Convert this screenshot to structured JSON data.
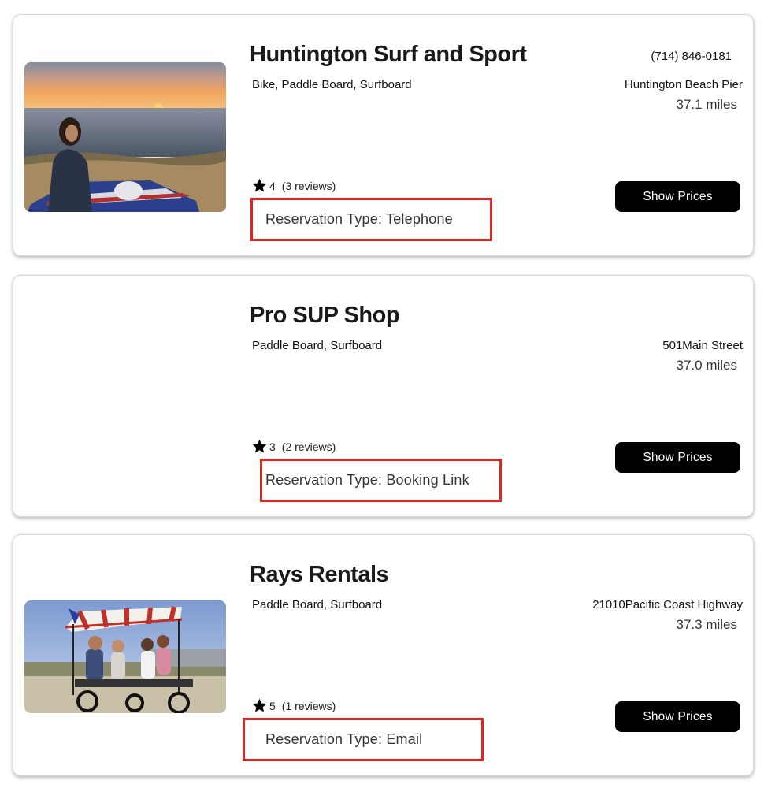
{
  "listings": [
    {
      "title": "Huntington Surf and Sport",
      "types": "Bike, Paddle Board, Surfboard",
      "phone": "(714) 846-0181",
      "address": "Huntington Beach Pier",
      "distance": "37.1 miles",
      "rating": "4",
      "reviews": "(3 reviews)",
      "reservation": "Reservation Type: Telephone",
      "button": "Show Prices",
      "image": "sunset-beach-photo"
    },
    {
      "title": "Pro SUP Shop",
      "types": "Paddle Board, Surfboard",
      "address": "501Main Street",
      "distance": "37.0 miles",
      "rating": "3",
      "reviews": "(2 reviews)",
      "reservation": "Reservation Type: Booking Link",
      "button": "Show Prices"
    },
    {
      "title": "Rays Rentals",
      "types": "Paddle Board, Surfboard",
      "address": "21010Pacific Coast Highway",
      "distance": "37.3 miles",
      "rating": "5",
      "reviews": "(1 reviews)",
      "reservation": "Reservation Type: Email",
      "button": "Show Prices",
      "image": "surrey-bike-family-photo"
    }
  ],
  "colors": {
    "highlight_border": "#e0261e",
    "button_bg": "#000000",
    "button_text": "#ffffff"
  },
  "icons": {
    "rating": "star-icon"
  }
}
